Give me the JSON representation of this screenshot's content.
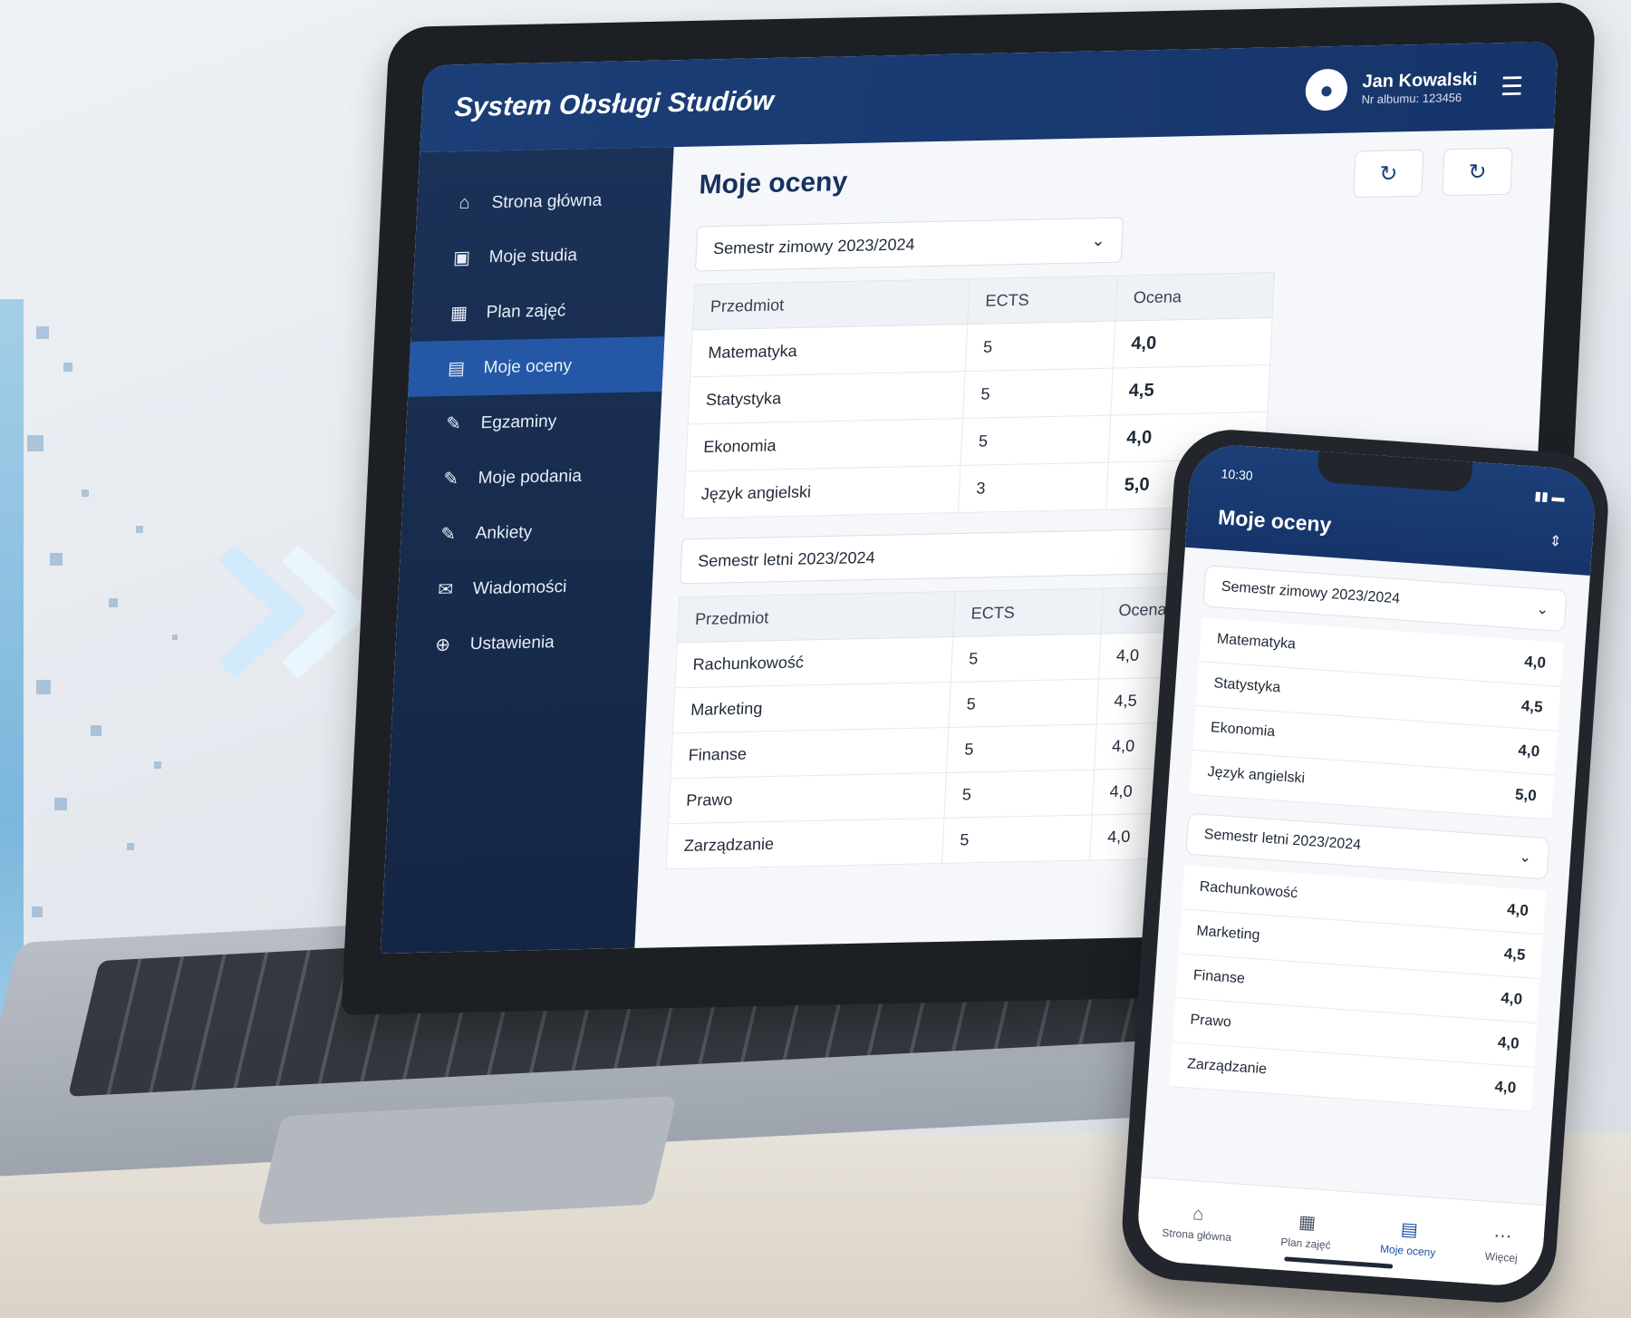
{
  "app": {
    "title": "System Obsługi Studiów",
    "user_name": "Jan Kowalski",
    "user_album": "Nr albumu: 123456"
  },
  "sidebar": {
    "items": [
      {
        "label": "Strona główna",
        "icon": "home-icon"
      },
      {
        "label": "Moje studia",
        "icon": "clipboard-icon"
      },
      {
        "label": "Plan zajęć",
        "icon": "calendar-icon"
      },
      {
        "label": "Moje oceny",
        "icon": "grades-icon",
        "active": true
      },
      {
        "label": "Egzaminy",
        "icon": "edit-icon"
      },
      {
        "label": "Moje podania",
        "icon": "edit-icon"
      },
      {
        "label": "Ankiety",
        "icon": "edit-icon"
      },
      {
        "label": "Wiadomości",
        "icon": "mail-icon"
      },
      {
        "label": "Ustawienia",
        "icon": "settings-icon"
      }
    ]
  },
  "main": {
    "title": "Moje oceny",
    "table_headers": {
      "subject": "Przedmiot",
      "ects": "ECTS",
      "grade": "Ocena"
    },
    "winter": {
      "semester": "Semestr zimowy 2023/2024",
      "rows": [
        {
          "subject": "Matematyka",
          "ects": "5",
          "grade": "4,0"
        },
        {
          "subject": "Statystyka",
          "ects": "5",
          "grade": "4,5"
        },
        {
          "subject": "Ekonomia",
          "ects": "5",
          "grade": "4,0"
        },
        {
          "subject": "Język angielski",
          "ects": "3",
          "grade": "5,0"
        }
      ]
    },
    "summer": {
      "semester": "Semestr letni 2023/2024",
      "rows": [
        {
          "subject": "Rachunkowość",
          "ects": "5",
          "grade": "4,0"
        },
        {
          "subject": "Marketing",
          "ects": "5",
          "grade": "4,5"
        },
        {
          "subject": "Finanse",
          "ects": "5",
          "grade": "4,0"
        },
        {
          "subject": "Prawo",
          "ects": "5",
          "grade": "4,0"
        },
        {
          "subject": "Zarządzanie",
          "ects": "5",
          "grade": "4,0"
        }
      ]
    }
  },
  "phone": {
    "time": "10:30",
    "title": "Moje oceny",
    "nav": [
      {
        "label": "Strona główna",
        "icon": "home-icon"
      },
      {
        "label": "Plan zajęć",
        "icon": "calendar-icon"
      },
      {
        "label": "Moje oceny",
        "icon": "grades-icon",
        "active": true
      },
      {
        "label": "Więcej",
        "icon": "more-icon"
      }
    ]
  },
  "colors": {
    "primary": "#1c3f78",
    "sidebar": "#1b3157",
    "active": "#2458a6"
  }
}
